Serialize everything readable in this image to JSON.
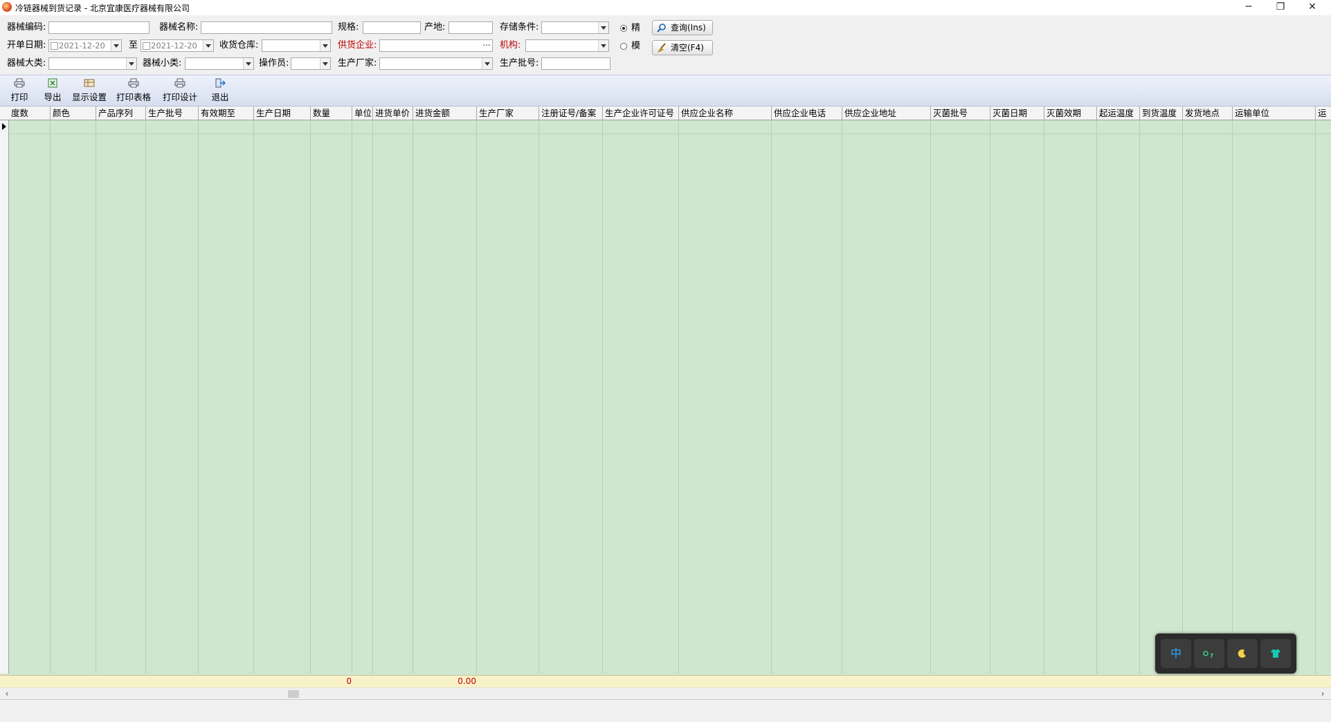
{
  "window": {
    "title": "冷链器械到货记录 - 北京宜康医疗器械有限公司",
    "controls": [
      "─",
      "❐",
      "✕"
    ]
  },
  "filters": {
    "row1": {
      "code_label": "器械编码:",
      "name_label": "器械名称:",
      "spec_label": "规格:",
      "origin_label": "产地:",
      "storage_label": "存储条件:",
      "exact_label": "精"
    },
    "row2": {
      "date_label": "开单日期:",
      "date_from": "2021-12-20",
      "to_label": "至",
      "date_to": "2021-12-20",
      "warehouse_label": "收货仓库:",
      "supplier_label": "供货企业:",
      "org_label": "机构:",
      "fuzzy_label": "模"
    },
    "row3": {
      "category_label": "器械大类:",
      "subcategory_label": "器械小类:",
      "operator_label": "操作员:",
      "manufacturer_label": "生产厂家:",
      "batch_label": "生产批号:"
    },
    "query_button": "查询(Ins)",
    "clear_button": "清空(F4)"
  },
  "toolbar": {
    "print": "打印",
    "export": "导出",
    "display_settings": "显示设置",
    "print_table": "打印表格",
    "print_design": "打印设计",
    "exit": "退出"
  },
  "grid": {
    "columns": [
      "度数",
      "颜色",
      "产品序列",
      "生产批号",
      "有效期至",
      "生产日期",
      "数量",
      "单位",
      "进货单价",
      "进货金额",
      "生产厂家",
      "注册证号/备案",
      "生产企业许可证号",
      "供应企业名称",
      "供应企业电话",
      "供应企业地址",
      "灭菌批号",
      "灭菌日期",
      "灭菌效期",
      "起运温度",
      "到货温度",
      "发货地点",
      "运输单位",
      "运"
    ],
    "footer": {
      "quantity_total": "0",
      "amount_total": "0.00"
    }
  },
  "ime": {
    "lang": "中"
  },
  "colors": {
    "grid_bg": "#cfe6cf",
    "footer_bg": "#f8f2c8",
    "red_label": "#c00000"
  }
}
